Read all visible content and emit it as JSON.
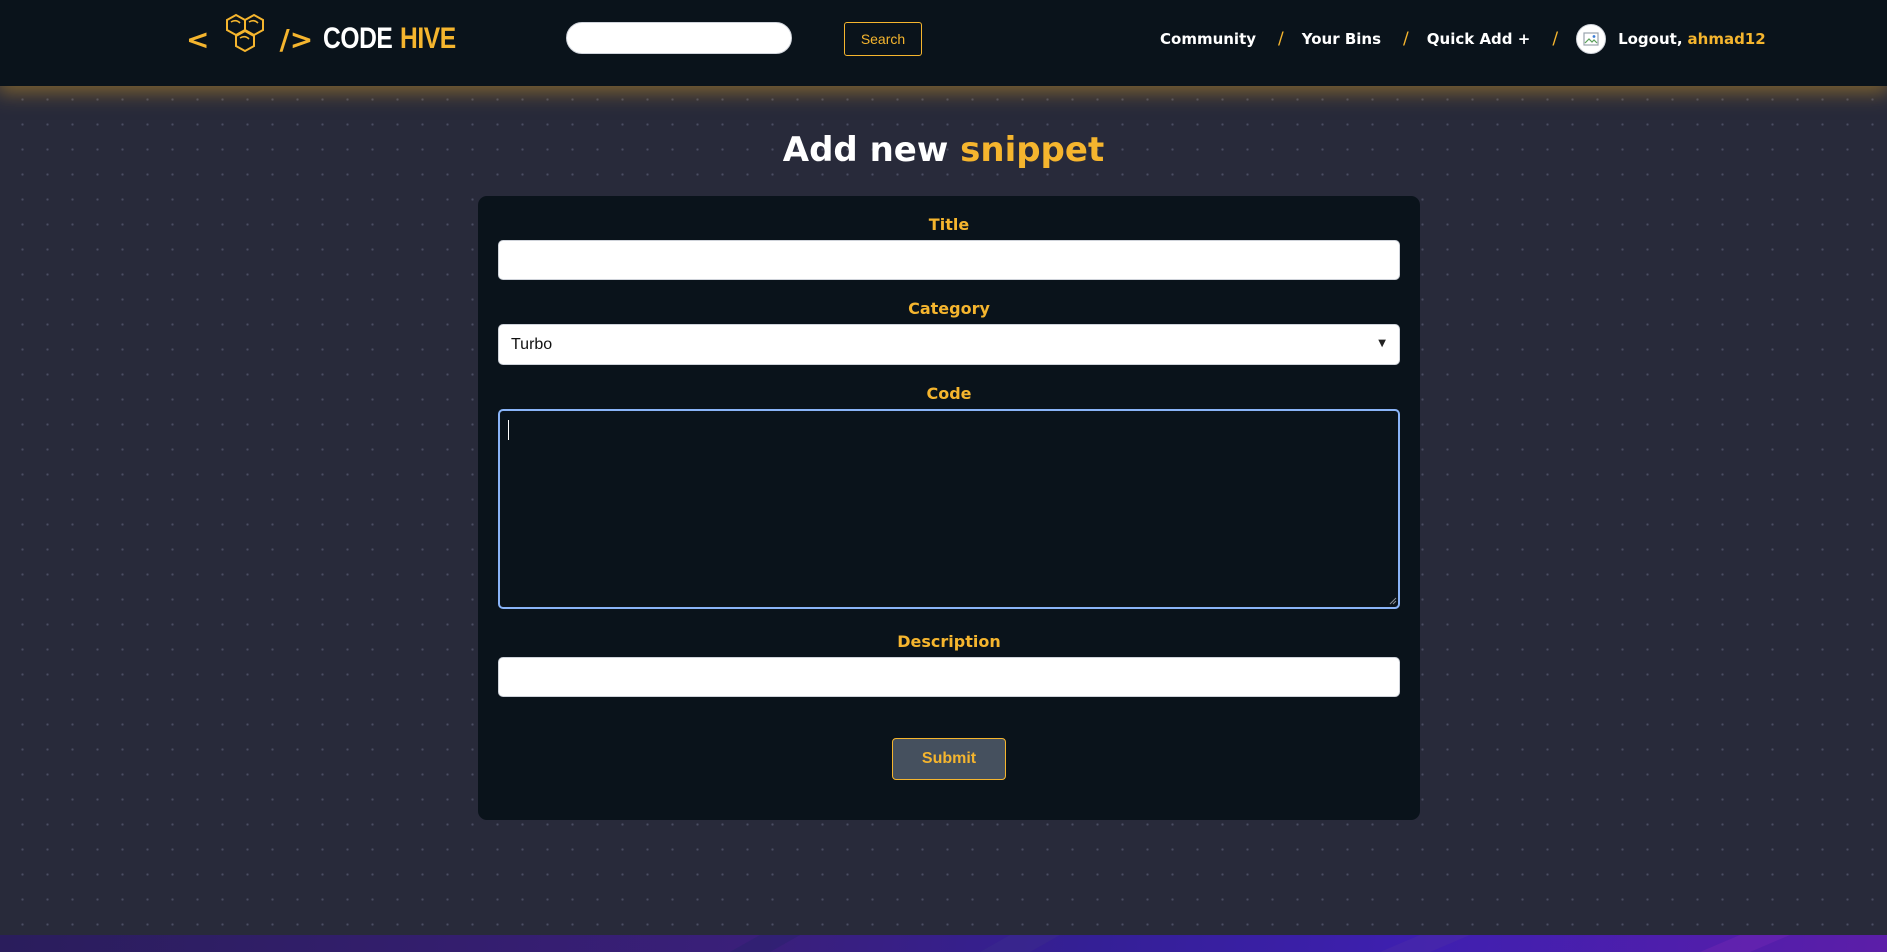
{
  "header": {
    "logo": {
      "bracket_open": "<",
      "bracket_close": "/>",
      "word_code": "CODE",
      "word_hive": "HIVE",
      "icon": "hexagon-cluster-icon"
    },
    "search": {
      "placeholder": "",
      "value": "",
      "button_label": "Search"
    },
    "nav": {
      "items": [
        {
          "label": "Community"
        },
        {
          "label": "Your Bins"
        },
        {
          "label": "Quick Add +"
        }
      ],
      "separator": "/",
      "avatar_icon": "user-avatar-icon",
      "logout_label": "Logout,",
      "username": "ahmad12"
    }
  },
  "main": {
    "title_white": "Add new",
    "title_accent": "snippet",
    "form": {
      "title_label": "Title",
      "title_value": "",
      "category_label": "Category",
      "category_selected": "Turbo",
      "code_label": "Code",
      "code_value": "",
      "description_label": "Description",
      "description_value": "",
      "submit_label": "Submit"
    }
  },
  "colors": {
    "accent": "#f5b52e",
    "header_bg": "#0a131b",
    "page_bg": "#282a3a",
    "card_bg": "#0a131b",
    "focus_ring": "#8ab4f8",
    "submit_bg": "#45505e"
  }
}
